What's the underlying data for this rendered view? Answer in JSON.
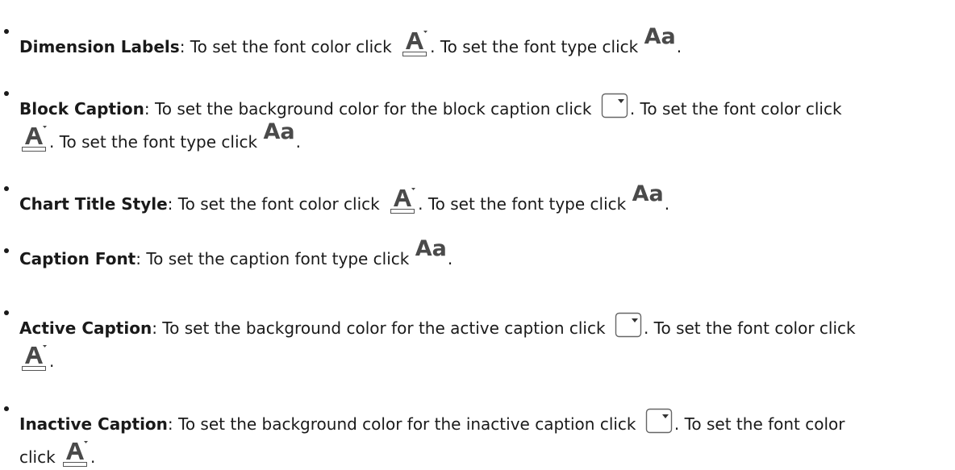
{
  "icons": {
    "font_color": "font-color-icon",
    "font_type": "font-type-icon",
    "background_color": "background-color-icon",
    "font_type_glyph": "Aa"
  },
  "items": [
    {
      "term": "Dimension Labels",
      "sep": ":",
      "t1": " To set the font color click ",
      "t2": ". To set the font type click ",
      "t3": "."
    },
    {
      "term": "Block Caption",
      "sep": ":",
      "t1": " To set the background color for the block caption click ",
      "t2": ". To set the font color click",
      "t3": ". To set the font type click ",
      "t4": "."
    },
    {
      "term": "Chart Title Style",
      "sep": ":",
      "t1": " To set the font color click ",
      "t2": ". To set the font type click ",
      "t3": "."
    },
    {
      "term": "Caption Font",
      "sep": ":",
      "t1": " To set the caption font type click ",
      "t2": "."
    },
    {
      "term": "Active Caption",
      "sep": ":",
      "t1": " To set the background color for the active caption click ",
      "t2": ". To set the font color click",
      "t3": "."
    },
    {
      "term": "Inactive Caption",
      "sep": ":",
      "t1": " To set the background color for the inactive caption click ",
      "t2": ". To set the font color",
      "t3": "click ",
      "t4": "."
    }
  ]
}
